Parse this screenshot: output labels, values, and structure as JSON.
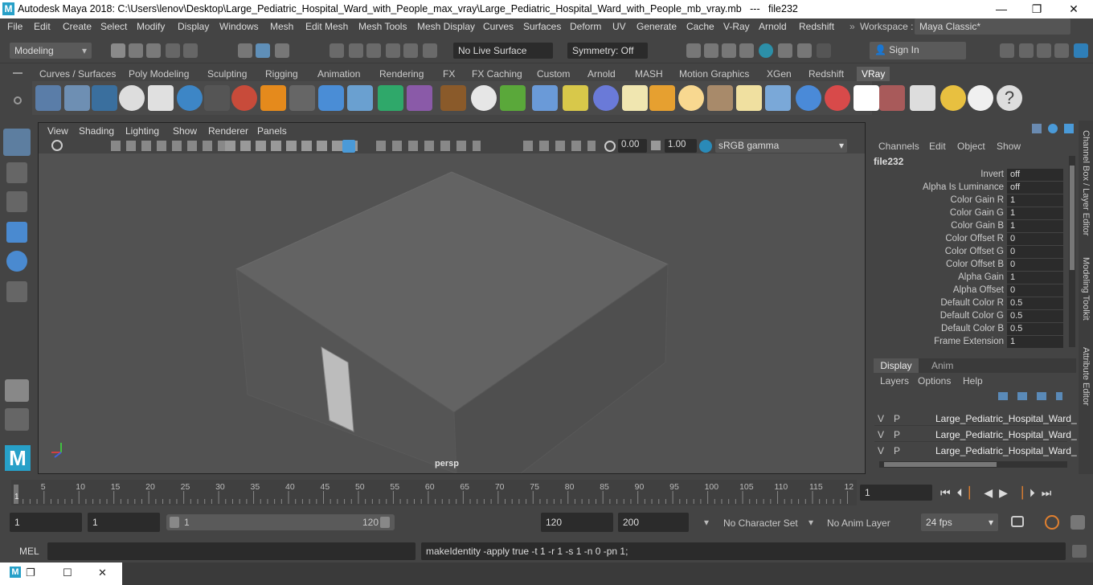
{
  "title_bar": {
    "app_title": "Autodesk Maya 2018: C:\\Users\\lenov\\Desktop\\Large_Pediatric_Hospital_Ward_with_People_max_vray\\Large_Pediatric_Hospital_Ward_with_People_mb_vray.mb   ---   file232",
    "logo": "M",
    "minimize": "—",
    "maximize": "❐",
    "close": "✕"
  },
  "menu": [
    "File",
    "Edit",
    "Create",
    "Select",
    "Modify",
    "Display",
    "Windows",
    "Mesh",
    "Edit Mesh",
    "Mesh Tools",
    "Mesh Display",
    "Curves",
    "Surfaces",
    "Deform",
    "UV",
    "Generate",
    "Cache",
    "V-Ray",
    "Arnold",
    "Redshift"
  ],
  "menu_more": "»",
  "workspace": {
    "label": "Workspace :",
    "value": "Maya Classic*"
  },
  "toolbar": {
    "mode": "Modeling",
    "live_surface": "No Live Surface",
    "symmetry": "Symmetry: Off",
    "sign_in": "Sign In"
  },
  "shelf_tabs": [
    "Curves / Surfaces",
    "Poly Modeling",
    "Sculpting",
    "Rigging",
    "Animation",
    "Rendering",
    "FX",
    "FX Caching",
    "Custom",
    "Arnold",
    "MASH",
    "Motion Graphics",
    "XGen",
    "Redshift",
    "VRay"
  ],
  "shelf_active": "VRay",
  "viewport": {
    "menus": [
      "View",
      "Shading",
      "Lighting",
      "Show",
      "Renderer",
      "Panels"
    ],
    "exposure": "0.00",
    "gamma": "1.00",
    "color_space": "sRGB gamma",
    "camera": "persp"
  },
  "channel_box": {
    "menus": [
      "Channels",
      "Edit",
      "Object",
      "Show"
    ],
    "node": "file232",
    "attrs": [
      {
        "name": "Invert",
        "value": "off"
      },
      {
        "name": "Alpha Is Luminance",
        "value": "off"
      },
      {
        "name": "Color Gain R",
        "value": "1"
      },
      {
        "name": "Color Gain G",
        "value": "1"
      },
      {
        "name": "Color Gain B",
        "value": "1"
      },
      {
        "name": "Color Offset R",
        "value": "0"
      },
      {
        "name": "Color Offset G",
        "value": "0"
      },
      {
        "name": "Color Offset B",
        "value": "0"
      },
      {
        "name": "Alpha Gain",
        "value": "1"
      },
      {
        "name": "Alpha Offset",
        "value": "0"
      },
      {
        "name": "Default Color R",
        "value": "0.5"
      },
      {
        "name": "Default Color G",
        "value": "0.5"
      },
      {
        "name": "Default Color B",
        "value": "0.5"
      },
      {
        "name": "Frame Extension",
        "value": "1"
      }
    ]
  },
  "layer_editor": {
    "tabs": [
      "Display",
      "Anim"
    ],
    "menus": [
      "Layers",
      "Options",
      "Help"
    ],
    "layers": [
      {
        "v": "V",
        "p": "P",
        "name": "Large_Pediatric_Hospital_Ward_"
      },
      {
        "v": "V",
        "p": "P",
        "name": "Large_Pediatric_Hospital_Ward_"
      },
      {
        "v": "V",
        "p": "P",
        "name": "Large_Pediatric_Hospital_Ward_"
      }
    ]
  },
  "side_tabs": [
    "Channel Box / Layer Editor",
    "Modeling Toolkit",
    "Attribute Editor"
  ],
  "timeline": {
    "ticks": [
      "5",
      "10",
      "15",
      "20",
      "25",
      "30",
      "35",
      "40",
      "45",
      "50",
      "55",
      "60",
      "65",
      "70",
      "75",
      "80",
      "85",
      "90",
      "95",
      "100",
      "105",
      "110",
      "115",
      "12"
    ],
    "start_mark": "1",
    "current_frame": "1"
  },
  "range": {
    "start": "1",
    "playback_start": "1",
    "slider_start": "1",
    "slider_end": "120",
    "playback_end": "120",
    "end": "200",
    "character_set": "No Character Set",
    "anim_layer": "No Anim Layer",
    "fps": "24 fps"
  },
  "command": {
    "lang": "MEL",
    "output": "makeIdentity -apply true -t 1 -r 1 -s 1 -n 0 -pn 1;"
  }
}
